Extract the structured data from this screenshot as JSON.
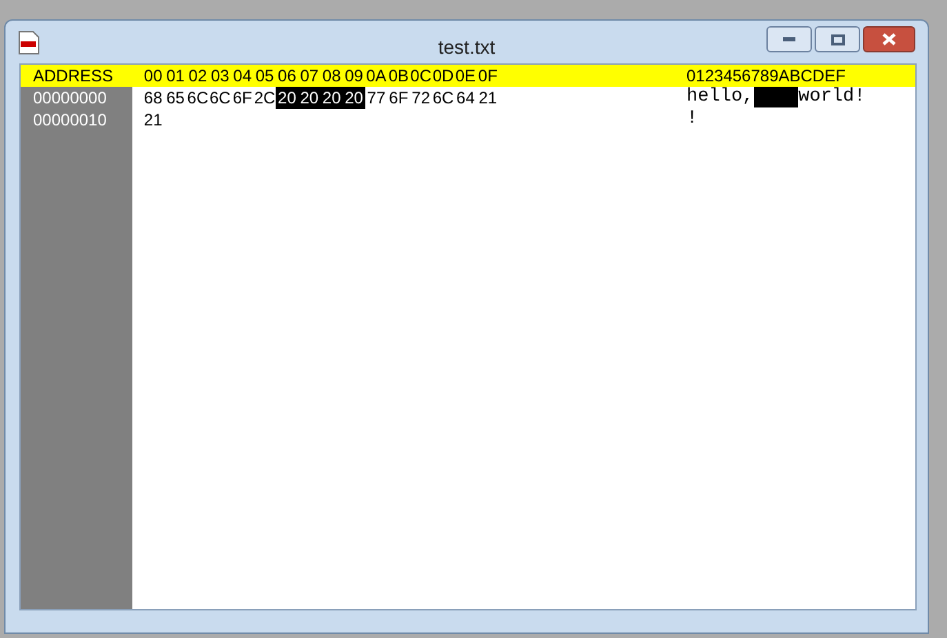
{
  "window": {
    "title": "test.txt"
  },
  "header": {
    "address": "ADDRESS",
    "columns": [
      "00",
      "01",
      "02",
      "03",
      "04",
      "05",
      "06",
      "07",
      "08",
      "09",
      "0A",
      "0B",
      "0C",
      "0D",
      "0E",
      "0F"
    ],
    "ascii": "0123456789ABCDEF"
  },
  "rows": [
    {
      "address": "00000000",
      "bytes": [
        {
          "hex": "68",
          "selected": false
        },
        {
          "hex": "65",
          "selected": false
        },
        {
          "hex": "6C",
          "selected": false
        },
        {
          "hex": "6C",
          "selected": false
        },
        {
          "hex": "6F",
          "selected": false
        },
        {
          "hex": "2C",
          "selected": false
        },
        {
          "hex": "20",
          "selected": true
        },
        {
          "hex": "20",
          "selected": true
        },
        {
          "hex": "20",
          "selected": true
        },
        {
          "hex": "20",
          "selected": true
        },
        {
          "hex": "77",
          "selected": false
        },
        {
          "hex": "6F",
          "selected": false
        },
        {
          "hex": "72",
          "selected": false
        },
        {
          "hex": "6C",
          "selected": false
        },
        {
          "hex": "64",
          "selected": false
        },
        {
          "hex": "21",
          "selected": false
        }
      ],
      "ascii": "hello,    world!"
    },
    {
      "address": "00000010",
      "bytes": [
        {
          "hex": "21",
          "selected": false
        }
      ],
      "ascii": "!"
    }
  ]
}
